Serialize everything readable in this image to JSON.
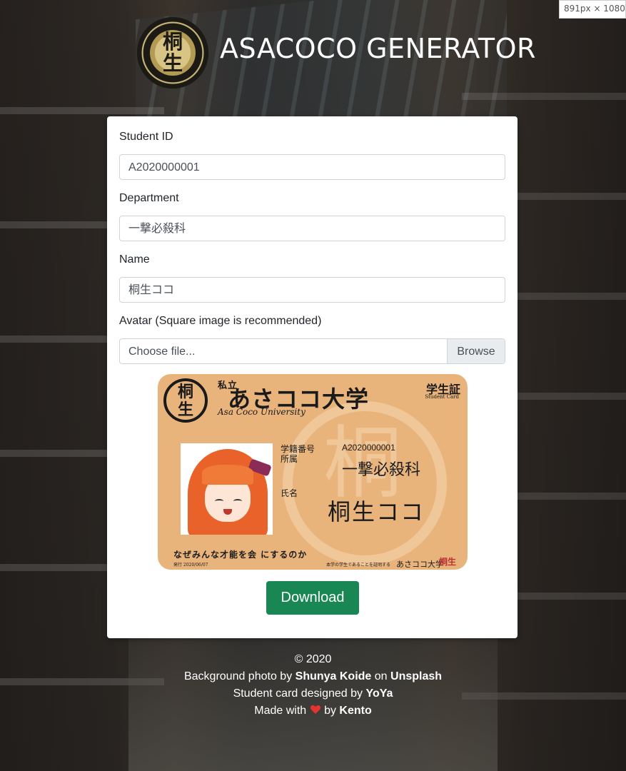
{
  "browser": {
    "size_badge": "891px × 1080px"
  },
  "header": {
    "logo_top": "桐",
    "logo_bottom": "生",
    "title": "ASACOCO GENERATOR"
  },
  "form": {
    "student_id": {
      "label": "Student ID",
      "value": "A2020000001"
    },
    "department": {
      "label": "Department",
      "value": "一撃必殺科"
    },
    "name": {
      "label": "Name",
      "value": "桐生ココ"
    },
    "avatar": {
      "label": "Avatar (Square image is recommended)",
      "placeholder": "Choose file...",
      "browse": "Browse"
    }
  },
  "card": {
    "seal_top": "桐",
    "seal_bottom": "生",
    "uni_prefix": "私立",
    "uni_name": "あさココ大学",
    "uni_en": "Asa Coco University",
    "student": "学生証",
    "student_en": "Student Card",
    "id_label": "学籍番号",
    "dept_label": "所属",
    "name_label": "氏名",
    "id_value": "A2020000001",
    "dept_value": "一撃必殺科",
    "name_value": "桐生ココ",
    "motto": "なぜみんな才能を会 にするのか",
    "date": "発行 2020/06/07",
    "footer_small": "本学の学生であることを証明する",
    "footer_uni": "あさココ大学",
    "sign": "桐生"
  },
  "actions": {
    "download": "Download"
  },
  "footer": {
    "copyright": "© 2020",
    "bg_prefix": "Background photo by ",
    "bg_author": "Shunya Koide",
    "bg_on": " on ",
    "bg_site": "Unsplash",
    "design_prefix": "Student card designed by ",
    "designer": "YoYa",
    "made_prefix": "Made with ",
    "made_by": " by ",
    "author": "Kento"
  },
  "colors": {
    "download_bg": "#198754",
    "heart": "#e3342f"
  }
}
